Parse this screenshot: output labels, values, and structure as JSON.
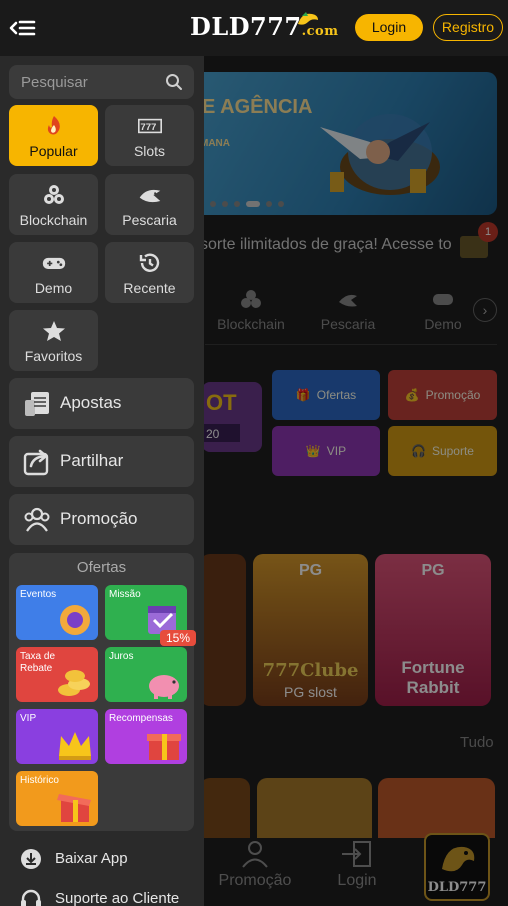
{
  "header": {
    "logo_text": "DLD777",
    "logo_suffix": ".com",
    "login_label": "Login",
    "register_label": "Registro"
  },
  "drawer": {
    "search": {
      "placeholder": "Pesquisar"
    },
    "game_categories": [
      {
        "label": "Popular",
        "icon": "fire-icon",
        "active": true
      },
      {
        "label": "Slots",
        "icon": "slot-777-icon",
        "active": false
      },
      {
        "label": "Blockchain",
        "icon": "blockchain-icon",
        "active": false
      },
      {
        "label": "Pescaria",
        "icon": "shark-icon",
        "active": false
      },
      {
        "label": "Demo",
        "icon": "gamepad-icon",
        "active": false
      },
      {
        "label": "Recente",
        "icon": "history-icon",
        "active": false
      },
      {
        "label": "Favoritos",
        "icon": "star-icon",
        "active": false
      }
    ],
    "menu": [
      {
        "label": "Apostas",
        "icon": "bets-icon"
      },
      {
        "label": "Partilhar",
        "icon": "share-icon"
      },
      {
        "label": "Promoção",
        "icon": "users-icon"
      }
    ],
    "offers": {
      "title": "Ofertas",
      "items": [
        {
          "label": "Eventos",
          "color": "#3f7ee8"
        },
        {
          "label": "Missão",
          "color": "#2fb04f"
        },
        {
          "label": "Taxa de Rebate",
          "color": "#e0453f"
        },
        {
          "label": "Juros",
          "color": "#2fb04f",
          "badge": "15%"
        },
        {
          "label": "VIP",
          "color": "#8a3fe0"
        },
        {
          "label": "Recompensas",
          "color": "#b03fe0"
        },
        {
          "label": "Histórico",
          "color": "#f29a1c"
        }
      ]
    },
    "footer": [
      {
        "label": "Baixar App",
        "icon": "download-icon"
      },
      {
        "label": "Suporte ao Cliente",
        "icon": "headset-icon"
      }
    ]
  },
  "background": {
    "banner": {
      "title": "E AGÊNCIA",
      "subtitle": "MANA"
    },
    "marquee": "sorte ilimitados de graça! Acesse to",
    "mail_badge": "1",
    "categories": [
      "Blockchain",
      "Pescaria",
      "Demo"
    ],
    "tiles": [
      "Ofertas",
      "Promoção",
      "VIP",
      "Suporte"
    ],
    "games": [
      {
        "provider": "PG",
        "title": "777Clube",
        "subtitle": "PG slost"
      },
      {
        "provider": "PG",
        "title": "Fortune Rabbit",
        "subtitle": ""
      }
    ],
    "tudo_label": "Tudo",
    "bottom_nav": [
      {
        "label": "Promoção",
        "icon": "users-icon"
      },
      {
        "label": "Login",
        "icon": "login-icon"
      }
    ],
    "badge_text": "DLD777"
  },
  "colors": {
    "accent": "#f7b500",
    "panel": "#2a2a2a",
    "card": "#3a3a3a"
  }
}
